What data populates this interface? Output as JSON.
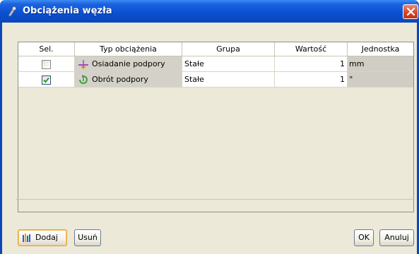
{
  "window": {
    "title": "Obciążenia węzła"
  },
  "table": {
    "columns": [
      "Sel.",
      "Typ obciążenia",
      "Grupa",
      "Wartość",
      "Jednostka"
    ],
    "rows": [
      {
        "selected": false,
        "type": "Osiadanie podpory",
        "type_icon": "settlement-icon",
        "group": "Stałe",
        "value": "1",
        "unit": "mm"
      },
      {
        "selected": true,
        "type": "Obrót podpory",
        "type_icon": "rotation-icon",
        "group": "Stałe",
        "value": "1",
        "unit": "°"
      }
    ]
  },
  "buttons": {
    "add": "Dodaj",
    "remove": "Usuń",
    "ok": "OK",
    "cancel": "Anuluj"
  },
  "colors": {
    "titlebar": "#0b47b8",
    "window_bg": "#ece9d8",
    "close": "#d9472a",
    "check": "#2b9a2b"
  }
}
